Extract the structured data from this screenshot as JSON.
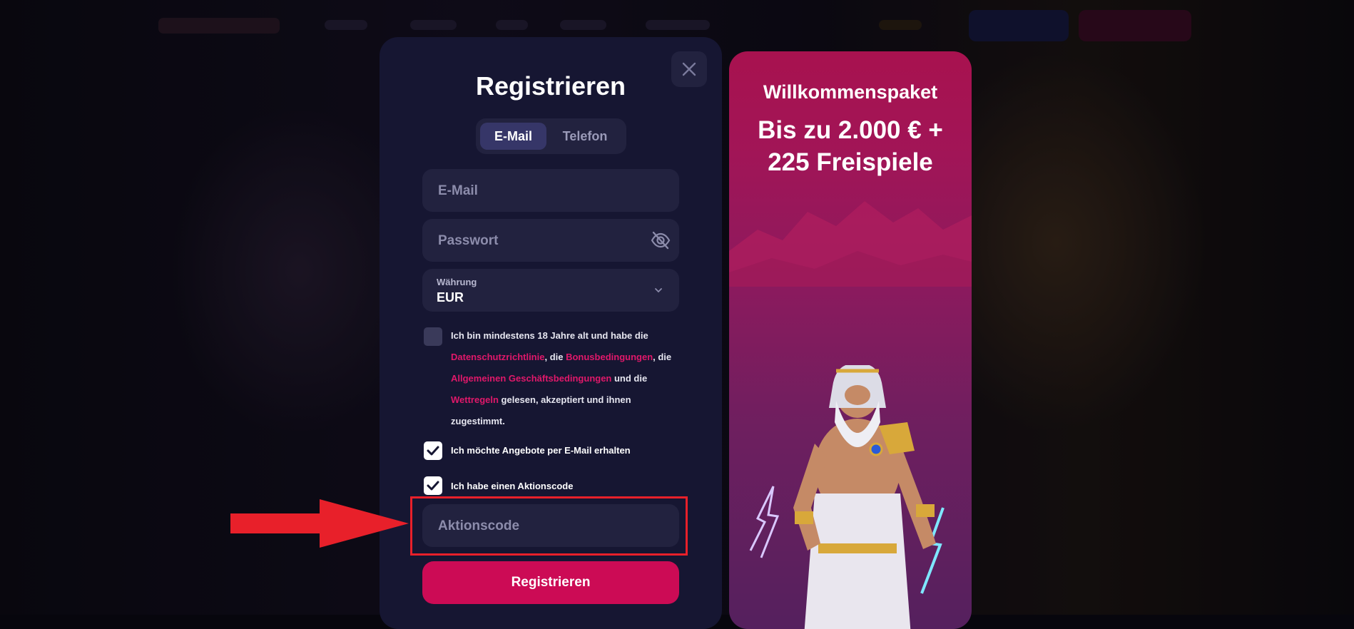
{
  "modal": {
    "title": "Registrieren",
    "tabs": [
      {
        "label": "E-Mail",
        "active": true
      },
      {
        "label": "Telefon",
        "active": false
      }
    ],
    "email_placeholder": "E-Mail",
    "password_placeholder": "Passwort",
    "currency": {
      "label": "Währung",
      "value": "EUR"
    },
    "terms": {
      "text_1": "Ich bin mindestens 18 Jahre alt und habe die ",
      "link_privacy": "Datenschutzrichtlinie",
      "text_2": ", die ",
      "link_bonus": "Bonusbedingungen",
      "text_3": ", die ",
      "link_gtc": "Allgemeinen Geschäftsbedingungen",
      "text_4": " und die ",
      "link_betting": "Wettregeln",
      "text_5": " gelesen, akzeptiert und ihnen zugestimmt.",
      "checked": false
    },
    "newsletter": {
      "label": "Ich möchte Angebote per E-Mail erhalten",
      "checked": true
    },
    "promo_code_toggle": {
      "label": "Ich habe einen Aktionscode",
      "checked": true
    },
    "promo_code_placeholder": "Aktionscode",
    "submit_label": "Registrieren"
  },
  "promo": {
    "title": "Willkommenspaket",
    "offer": "Bis zu 2.000 € + 225 Freispiele"
  },
  "colors": {
    "accent": "#cc0b55",
    "link": "#e0186a",
    "modal_bg": "#161632",
    "field_bg": "#22223f",
    "highlight": "#e8202a"
  },
  "icons": [
    "close-icon",
    "eye-off-icon",
    "chevron-down-icon",
    "checkmark-icon",
    "arrow-icon"
  ]
}
